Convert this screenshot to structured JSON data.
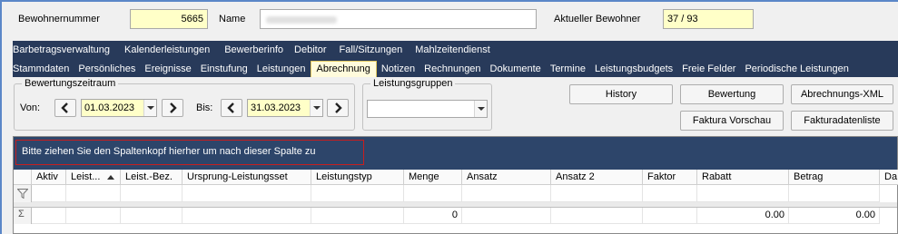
{
  "header": {
    "resident_number_label": "Bewohnernummer",
    "resident_number_value": "5665",
    "name_label": "Name",
    "current_resident_label": "Aktueller Bewohner",
    "current_resident_value": "37 / 93"
  },
  "nav": {
    "row1": [
      "Barbetragsverwaltung",
      "Kalenderleistungen",
      "Bewerberinfo",
      "Debitor",
      "Fall/Sitzungen",
      "Mahlzeitendienst"
    ],
    "row2": [
      "Stammdaten",
      "Persönliches",
      "Ereignisse",
      "Einstufung",
      "Leistungen",
      "Abrechnung",
      "Notizen",
      "Rechnungen",
      "Dokumente",
      "Termine",
      "Leistungsbudgets",
      "Freie Felder",
      "Periodische Leistungen"
    ],
    "active_tab": "Abrechnung"
  },
  "period": {
    "title": "Bewertungszeitraum",
    "from_label": "Von:",
    "from_value": "01.03.2023",
    "to_label": "Bis:",
    "to_value": "31.03.2023"
  },
  "groups": {
    "title": "Leistungsgruppen",
    "value": ""
  },
  "buttons": {
    "history": "History",
    "bewertung": "Bewertung",
    "abrechnungs_xml": "Abrechnungs-XML",
    "faktura_vorschau": "Faktura Vorschau",
    "fakturadatenliste": "Fakturadatenliste"
  },
  "grid": {
    "group_hint": "Bitte ziehen Sie den Spaltenkopf hierher um nach dieser Spalte zu gruppieren.",
    "columns": [
      "Aktiv",
      "Leist...",
      "Leist.-Bez.",
      "Ursprung-Leistungsset",
      "Leistungstyp",
      "Menge",
      "Ansatz",
      "Ansatz 2",
      "Faktor",
      "Rabatt",
      "Betrag",
      "Da"
    ],
    "summary": {
      "menge": "0",
      "rabatt": "0.00",
      "betrag": "0.00"
    }
  },
  "colors": {
    "nav_bg": "#283a5a",
    "field_bg": "#ffffc8",
    "grid_band": "#2d456a",
    "hint_border": "#c81e1e"
  }
}
